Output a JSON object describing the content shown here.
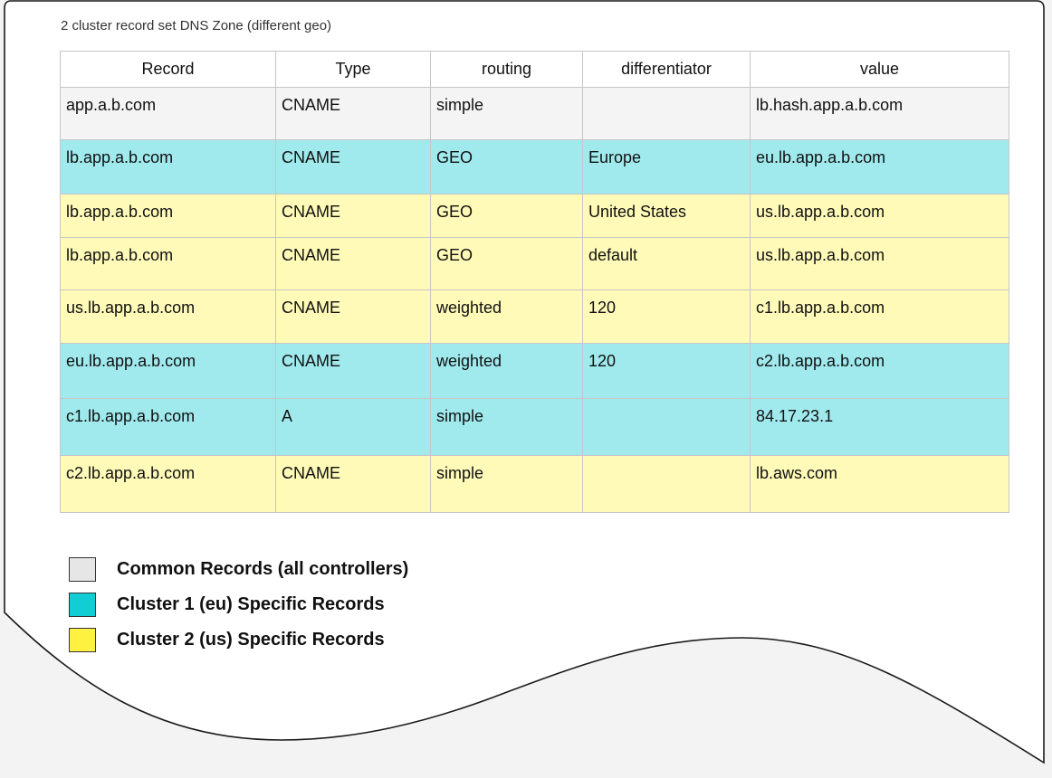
{
  "caption": "2 cluster record set DNS Zone (different geo)",
  "table": {
    "headers": [
      "Record",
      "Type",
      "routing",
      "differentiator",
      "value"
    ],
    "rows": [
      {
        "group": "common",
        "cells": [
          "app.a.b.com",
          "CNAME",
          "simple",
          "",
          "lb.hash.app.a.b.com"
        ]
      },
      {
        "group": "eu",
        "cells": [
          "lb.app.a.b.com",
          "CNAME",
          "GEO",
          "Europe",
          "eu.lb.app.a.b.com"
        ]
      },
      {
        "group": "us",
        "cells": [
          "lb.app.a.b.com",
          "CNAME",
          "GEO",
          "United States",
          "us.lb.app.a.b.com"
        ]
      },
      {
        "group": "us",
        "cells": [
          "lb.app.a.b.com",
          "CNAME",
          "GEO",
          "default",
          "us.lb.app.a.b.com"
        ]
      },
      {
        "group": "us",
        "cells": [
          "us.lb.app.a.b.com",
          "CNAME",
          "weighted",
          "120",
          "c1.lb.app.a.b.com"
        ]
      },
      {
        "group": "eu",
        "cells": [
          "eu.lb.app.a.b.com",
          "CNAME",
          "weighted",
          "120",
          "c2.lb.app.a.b.com"
        ]
      },
      {
        "group": "eu",
        "cells": [
          "c1.lb.app.a.b.com",
          "A",
          "simple",
          "",
          "84.17.23.1"
        ]
      },
      {
        "group": "us",
        "cells": [
          "c2.lb.app.a.b.com",
          "CNAME",
          "simple",
          "",
          "lb.aws.com"
        ]
      }
    ]
  },
  "legend": [
    {
      "label": "Common Records (all controllers)",
      "color": "#e6e6e6"
    },
    {
      "label": "Cluster 1 (eu) Specific Records",
      "color": "#12ccd6"
    },
    {
      "label": "Cluster 2 (us) Specific Records",
      "color": "#fff141"
    }
  ]
}
